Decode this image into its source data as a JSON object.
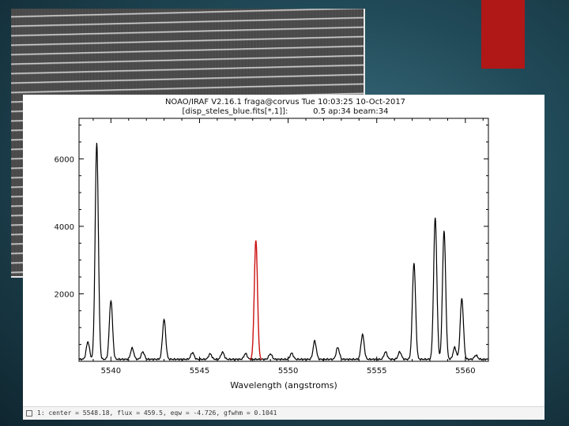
{
  "background_image": {
    "description_icon": "echelle-spectrum-image"
  },
  "accent_color": "#b01717",
  "plot": {
    "title_line1": "NOAO/IRAF V2.16.1 fraga@corvus Tue 10:03:25 10-Oct-2017",
    "title_line2": "[disp_steles_blue.fits[*,1]]:          0.5 ap:34 beam:34",
    "status_text": "1: center =   5548.18, flux =    459.5, eqw =  -4.726, gfwhm = 0.1041"
  },
  "chart_data": {
    "type": "line",
    "title": "NOAO/IRAF V2.16.1 fraga@corvus Tue 10:03:25 10-Oct-2017",
    "subtitle": "[disp_steles_blue.fits[*,1]]:          0.5 ap:34 beam:34",
    "xlabel": "Wavelength (angstroms)",
    "ylabel": "",
    "xlim": [
      5538.2,
      5561.3
    ],
    "ylim": [
      0,
      7200
    ],
    "xticks": [
      5540,
      5545,
      5550,
      5555,
      5560
    ],
    "yticks": [
      2000,
      4000,
      6000
    ],
    "grid": false,
    "baseline": 60,
    "series": [
      {
        "color": "#000000",
        "peaks": [
          {
            "x": 5538.7,
            "y": 520
          },
          {
            "x": 5539.2,
            "y": 6400
          },
          {
            "x": 5540.0,
            "y": 1750
          },
          {
            "x": 5541.2,
            "y": 330
          },
          {
            "x": 5541.8,
            "y": 220
          },
          {
            "x": 5543.0,
            "y": 1180
          },
          {
            "x": 5544.6,
            "y": 200
          },
          {
            "x": 5545.6,
            "y": 160
          },
          {
            "x": 5546.3,
            "y": 210
          },
          {
            "x": 5547.6,
            "y": 170
          },
          {
            "x": 5549.0,
            "y": 160
          },
          {
            "x": 5550.2,
            "y": 180
          },
          {
            "x": 5551.5,
            "y": 540
          },
          {
            "x": 5552.8,
            "y": 350
          },
          {
            "x": 5554.2,
            "y": 730
          },
          {
            "x": 5555.5,
            "y": 220
          },
          {
            "x": 5556.3,
            "y": 220
          },
          {
            "x": 5557.1,
            "y": 2850
          },
          {
            "x": 5558.3,
            "y": 4200
          },
          {
            "x": 5558.8,
            "y": 3800
          },
          {
            "x": 5559.4,
            "y": 350
          },
          {
            "x": 5559.8,
            "y": 1800
          },
          {
            "x": 5560.6,
            "y": 120
          }
        ]
      },
      {
        "color": "#cc1111",
        "peaks": [
          {
            "x": 5548.18,
            "y": 3520
          }
        ]
      }
    ]
  }
}
